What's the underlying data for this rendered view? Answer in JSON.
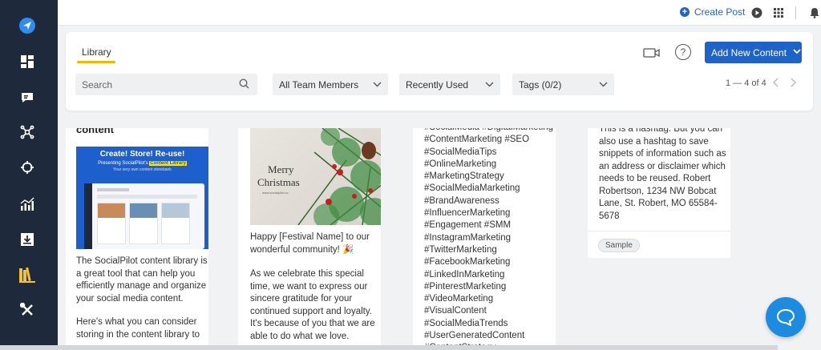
{
  "topbar": {
    "create_post": "Create Post"
  },
  "sidebar": {
    "items": [
      "send-icon",
      "dashboard-icon",
      "feedback-icon",
      "network-icon",
      "target-icon",
      "analytics-icon",
      "download-icon",
      "library-icon",
      "tools-icon"
    ]
  },
  "library": {
    "tab_label": "Library",
    "add_button": "Add New Content",
    "search_placeholder": "Search",
    "filter_team": "All Team Members",
    "filter_sort": "Recently Used",
    "filter_tags": "Tags (0/2)",
    "pagination": "1 — 4 of 4"
  },
  "cards": [
    {
      "title": "content",
      "image_title": "Create! Store! Re-use!",
      "image_subtitle_pre": "Presenting SocialPilot's",
      "image_subtitle_highlight": "Content Library",
      "image_caption": "Your very own content storebank",
      "paragraph1": "The SocialPilot content library is a great tool that can help you efficiently manage and organize your social media content.",
      "paragraph2": "Here's what you can consider storing in the content library to"
    },
    {
      "image_text_1": "Merry",
      "image_text_2": "Christmas",
      "image_url_text": "www.socialpilot.co",
      "paragraph1": "Happy [Festival Name] to our wonderful community! 🎉",
      "paragraph2": "As we celebrate this special time, we want to express our sincere gratitude for your continued support and loyalty. It's because of you that we are able to do what we love."
    },
    {
      "hashtags": "#SocialMedia #DigitalMarketing #ContentMarketing #SEO #SocialMediaTips #OnlineMarketing #MarketingStrategy #SocialMediaMarketing #BrandAwareness #InfluencerMarketing #Engagement #SMM #InstagramMarketing #TwitterMarketing #FacebookMarketing #LinkedInMarketing #PinterestMarketing #VideoMarketing #VisualContent #SocialMediaTrends #UserGeneratedContent #ContentStrategy"
    },
    {
      "text": "This is a hashtag. But you can also use a hashtag to save snippets of information such as an address or disclaimer which needs to be reused. Robert Robertson, 1234 NW Bobcat Lane, St. Robert, MO 65584-5678",
      "tag": "Sample"
    }
  ],
  "colors": {
    "sidebar": "#1e2a3c",
    "accent": "#1d63c8",
    "tab_underline": "#f7b500",
    "chat": "#1d8ce0"
  }
}
